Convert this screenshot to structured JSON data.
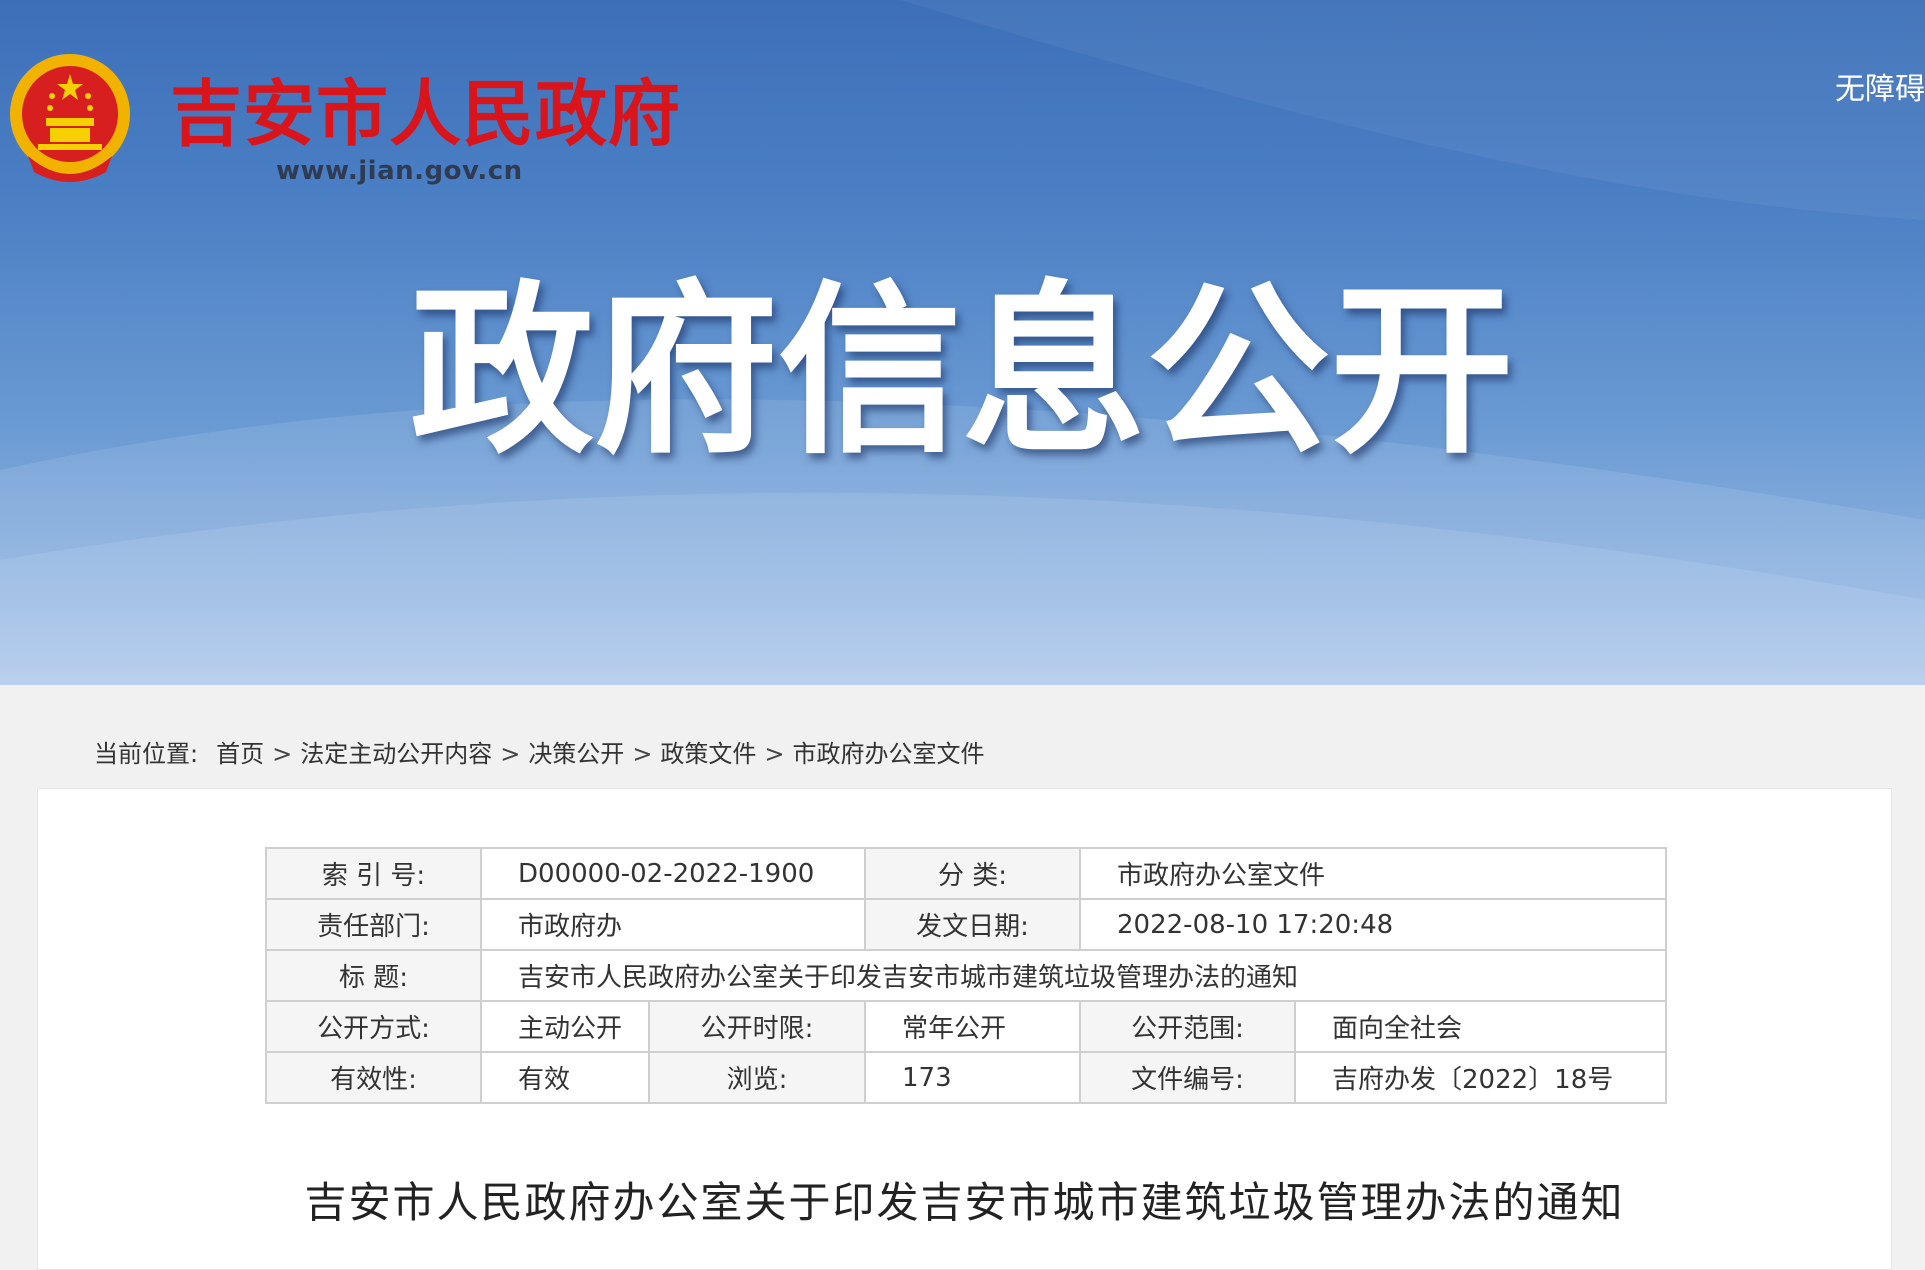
{
  "header": {
    "site_name": "吉安市人民政府",
    "site_url": "www.jian.gov.cn",
    "accessibility_label": "无障碍",
    "hero_title": "政府信息公开"
  },
  "breadcrumb": {
    "lead": "当前位置:",
    "items": [
      "首页",
      "法定主动公开内容",
      "决策公开",
      "政策文件",
      "市政府办公室文件"
    ],
    "separator": ">"
  },
  "meta": {
    "index_no_label": "索 引 号:",
    "index_no": "D00000-02-2022-1900",
    "category_label": "分 类:",
    "category": "市政府办公室文件",
    "dept_label": "责任部门:",
    "dept": "市政府办",
    "date_label": "发文日期:",
    "date": "2022-08-10 17:20:48",
    "title_label": "标 题:",
    "title": "吉安市人民政府办公室关于印发吉安市城市建筑垃圾管理办法的通知",
    "mode_label": "公开方式:",
    "mode": "主动公开",
    "period_label": "公开时限:",
    "period": "常年公开",
    "scope_label": "公开范围:",
    "scope": "面向全社会",
    "validity_label": "有效性:",
    "validity": "有效",
    "views_label": "浏览:",
    "views": "173",
    "doc_no_label": "文件编号:",
    "doc_no": "吉府办发〔2022〕18号"
  },
  "document": {
    "title": "吉安市人民政府办公室关于印发吉安市城市建筑垃圾管理办法的通知"
  },
  "colors": {
    "brand_red": "#d9141b",
    "banner_blue": "#4c80c5",
    "emblem_gold": "#f2b300"
  }
}
